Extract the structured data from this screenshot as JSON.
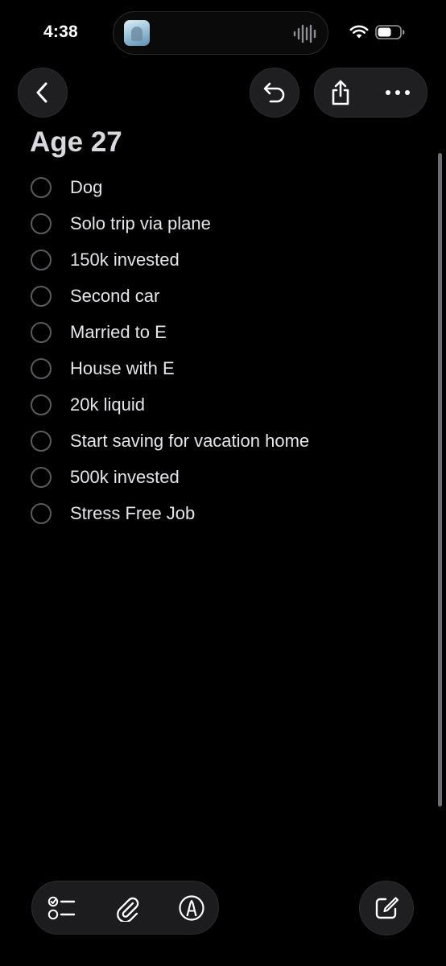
{
  "status_bar": {
    "time": "4:38",
    "icons": [
      "now-playing-thumbnail",
      "audio-waveform-icon",
      "wifi-icon",
      "battery-icon"
    ]
  },
  "nav": {
    "back_icon": "chevron-left-icon",
    "undo_icon": "undo-icon",
    "share_icon": "share-icon",
    "more_icon": "ellipsis-icon"
  },
  "note": {
    "title": "Age 27",
    "items": [
      {
        "text": "Dog",
        "checked": false
      },
      {
        "text": "Solo trip via plane",
        "checked": false
      },
      {
        "text": "150k invested",
        "checked": false
      },
      {
        "text": "Second car",
        "checked": false
      },
      {
        "text": "Married to E",
        "checked": false
      },
      {
        "text": "House with E",
        "checked": false
      },
      {
        "text": "20k liquid",
        "checked": false
      },
      {
        "text": "Start saving for vacation home",
        "checked": false
      },
      {
        "text": "500k invested",
        "checked": false
      },
      {
        "text": "Stress Free Job",
        "checked": false
      }
    ]
  },
  "toolbar": {
    "icons": [
      "checklist-icon",
      "paperclip-icon",
      "markup-pen-icon"
    ],
    "compose_icon": "compose-icon"
  },
  "colors": {
    "background": "#000000",
    "text": "#e6e6ea",
    "button_fill": "#1f1f22",
    "checkbox_stroke": "#5b5b5f"
  }
}
